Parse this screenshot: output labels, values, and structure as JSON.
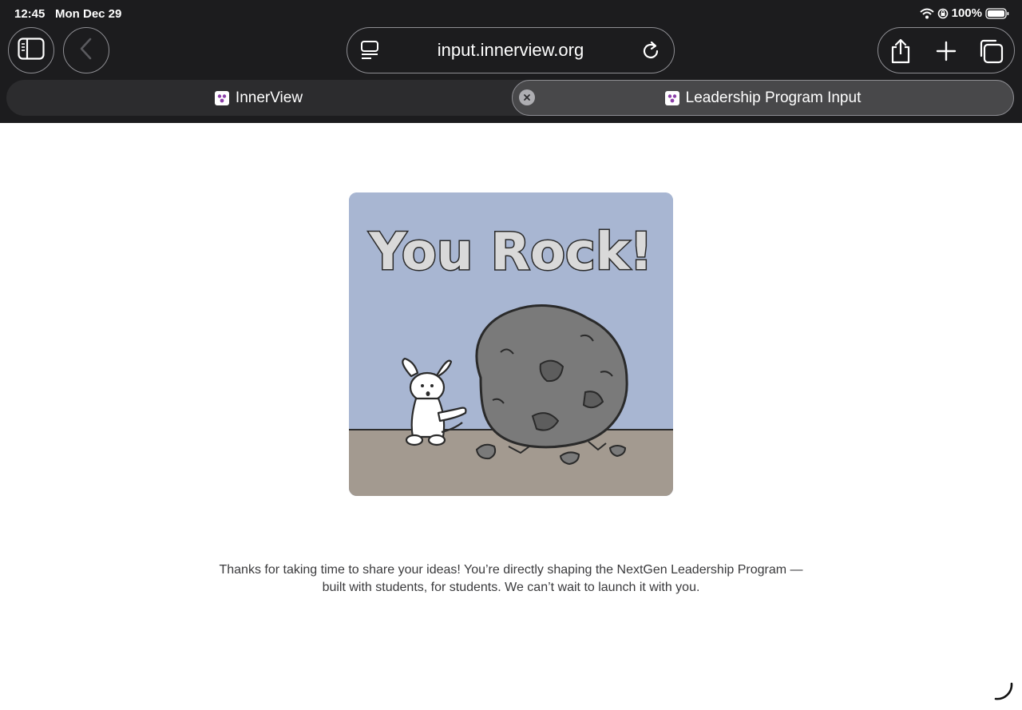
{
  "status_bar": {
    "time": "12:45",
    "date": "Mon Dec 29",
    "battery_percent": "100%"
  },
  "browser": {
    "url": "input.innerview.org",
    "tabs": [
      {
        "title": "InnerView",
        "active": false
      },
      {
        "title": "Leadership Program Input",
        "active": true
      }
    ]
  },
  "page": {
    "illustration_title": "You Rock!",
    "thanks_line1": "Thanks for taking  time to share your ideas! You’re directly shaping the NextGen Leadership Program —",
    "thanks_line2": "built with students, for students. We can’t wait to launch it with you."
  },
  "colors": {
    "chrome": "#1c1c1e",
    "sky": "#a8b6d2",
    "ground": "#a39a90",
    "rock": "#7a7a7a",
    "favicon_accent": "#8b3fa8"
  }
}
